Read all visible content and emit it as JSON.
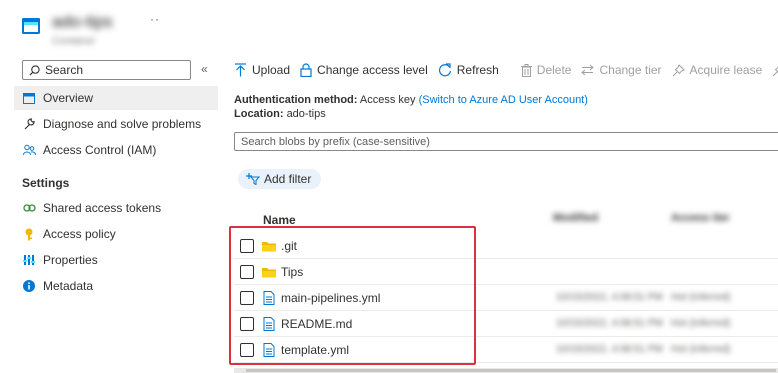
{
  "header": {
    "title": "ado-tips",
    "subtitle": "Container",
    "more": "··"
  },
  "sidebar": {
    "search_placeholder": "Search",
    "collapse": "«",
    "items": [
      {
        "label": "Overview",
        "icon": "overview-icon"
      },
      {
        "label": "Diagnose and solve problems",
        "icon": "wrench-icon"
      },
      {
        "label": "Access Control (IAM)",
        "icon": "people-icon"
      }
    ],
    "settings_heading": "Settings",
    "settings_items": [
      {
        "label": "Shared access tokens",
        "icon": "link-icon"
      },
      {
        "label": "Access policy",
        "icon": "key-icon"
      },
      {
        "label": "Properties",
        "icon": "properties-icon"
      },
      {
        "label": "Metadata",
        "icon": "info-icon"
      }
    ]
  },
  "toolbar": {
    "upload": "Upload",
    "change_access": "Change access level",
    "refresh": "Refresh",
    "delete": "Delete",
    "change_tier": "Change tier",
    "acquire_lease": "Acquire lease"
  },
  "info": {
    "auth_label": "Authentication method:",
    "auth_value": "Access key",
    "auth_link": "(Switch to Azure AD User Account)",
    "location_label": "Location:",
    "location_value": "ado-tips"
  },
  "blob_search_placeholder": "Search blobs by prefix (case-sensitive)",
  "add_filter": "Add filter",
  "table": {
    "columns": [
      "Name",
      "Modified",
      "Access tier"
    ],
    "rows": [
      {
        "name": ".git",
        "type": "folder",
        "modified": "",
        "access": ""
      },
      {
        "name": "Tips",
        "type": "folder",
        "modified": "",
        "access": ""
      },
      {
        "name": "main-pipelines.yml",
        "type": "file",
        "modified": "10/15/2022, 4:08:51 PM",
        "access": "Hot (Inferred)"
      },
      {
        "name": "README.md",
        "type": "file",
        "modified": "10/15/2022, 4:08:51 PM",
        "access": "Hot (Inferred)"
      },
      {
        "name": "template.yml",
        "type": "file",
        "modified": "10/15/2022, 4:08:51 PM",
        "access": "Hot (Inferred)"
      }
    ]
  },
  "colors": {
    "accent": "#0078d4",
    "highlight": "#d9313f",
    "folder": "#f2b705",
    "file": "#0078d4"
  }
}
